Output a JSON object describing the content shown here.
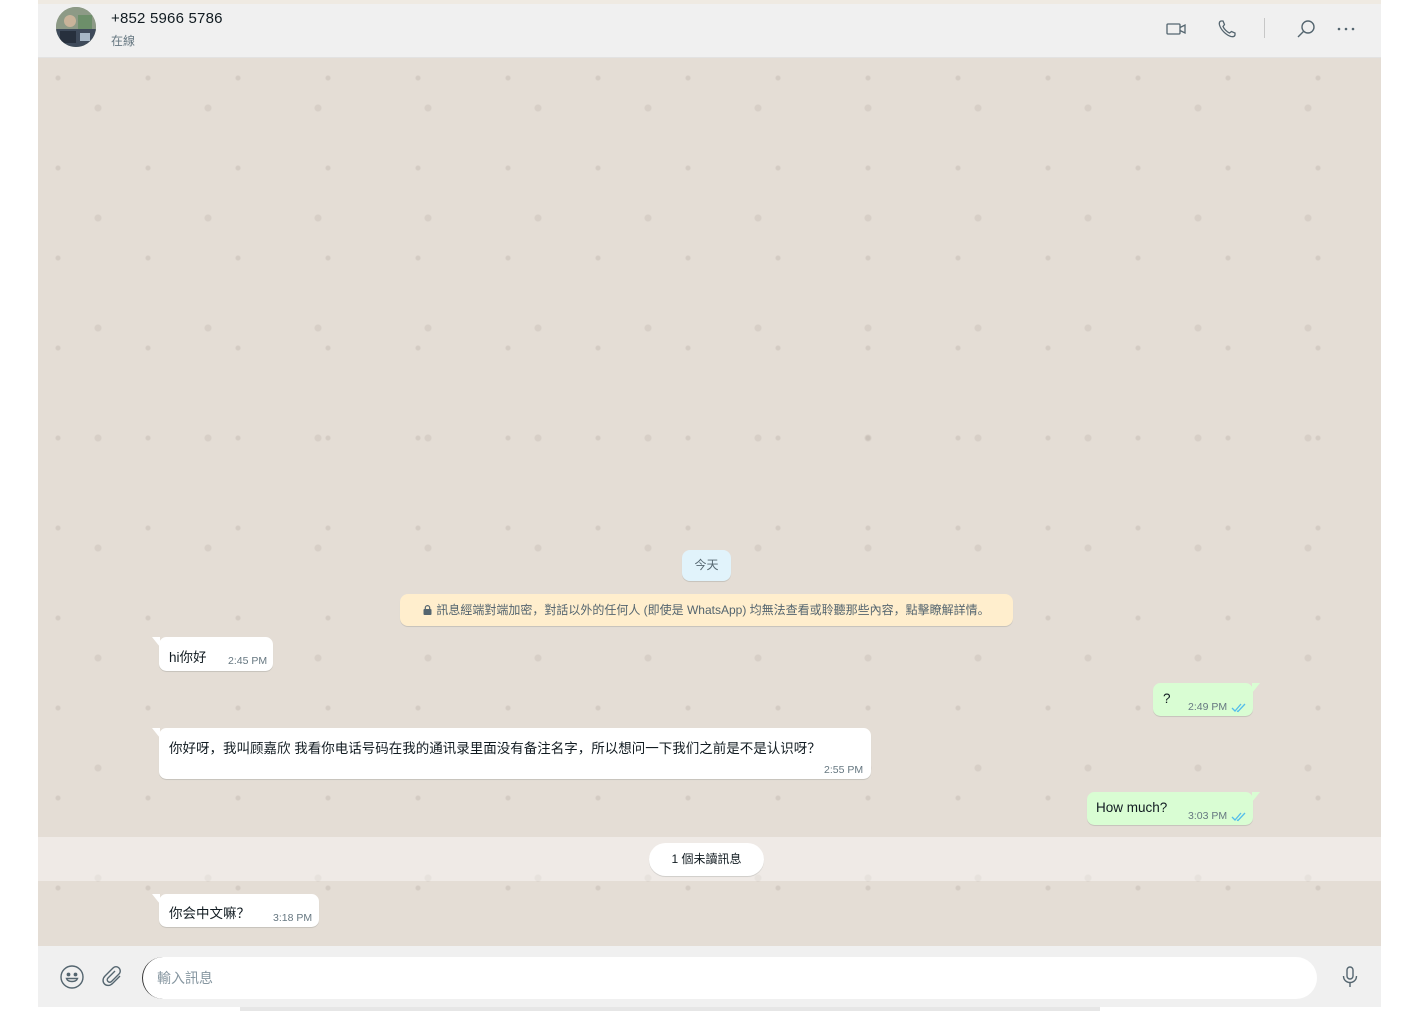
{
  "header": {
    "contact_name": "+852 5966 5786",
    "contact_status": "在線",
    "icons": [
      "video-call-icon",
      "voice-call-icon",
      "search-icon",
      "more-options-icon"
    ]
  },
  "chat": {
    "date_divider": "今天",
    "encryption_notice": "訊息經端對端加密，對話以外的任何人 (即使是 WhatsApp) 均無法查看或聆聽那些內容，點擊瞭解詳情。",
    "messages": [
      {
        "direction": "incoming",
        "text": "hi你好",
        "time": "2:45 PM"
      },
      {
        "direction": "outgoing",
        "text": "?",
        "time": "2:49 PM",
        "status": "read"
      },
      {
        "direction": "incoming",
        "text": "你好呀，我叫顾嘉欣 我看你电话号码在我的通讯录里面没有备注名字，所以想问一下我们之前是不是认识呀？",
        "time": "2:55 PM"
      },
      {
        "direction": "outgoing",
        "text": "How much?",
        "time": "3:03 PM",
        "status": "read"
      },
      {
        "direction": "incoming",
        "text": "你会中文嘛？",
        "time": "3:18 PM"
      }
    ],
    "unread_divider": "1 個未讀訊息"
  },
  "footer": {
    "input_placeholder": "輸入訊息",
    "icons": [
      "emoji-icon",
      "attach-icon",
      "microphone-icon"
    ]
  },
  "colors": {
    "header_bg": "#f0f0f0",
    "chat_bg": "#e4ddd5",
    "incoming_bubble": "#ffffff",
    "outgoing_bubble": "#d9fdd3",
    "read_ticks": "#53bdeb",
    "encryption_notice_bg": "#ffeecd",
    "date_pill_bg": "#e1f3fb"
  }
}
